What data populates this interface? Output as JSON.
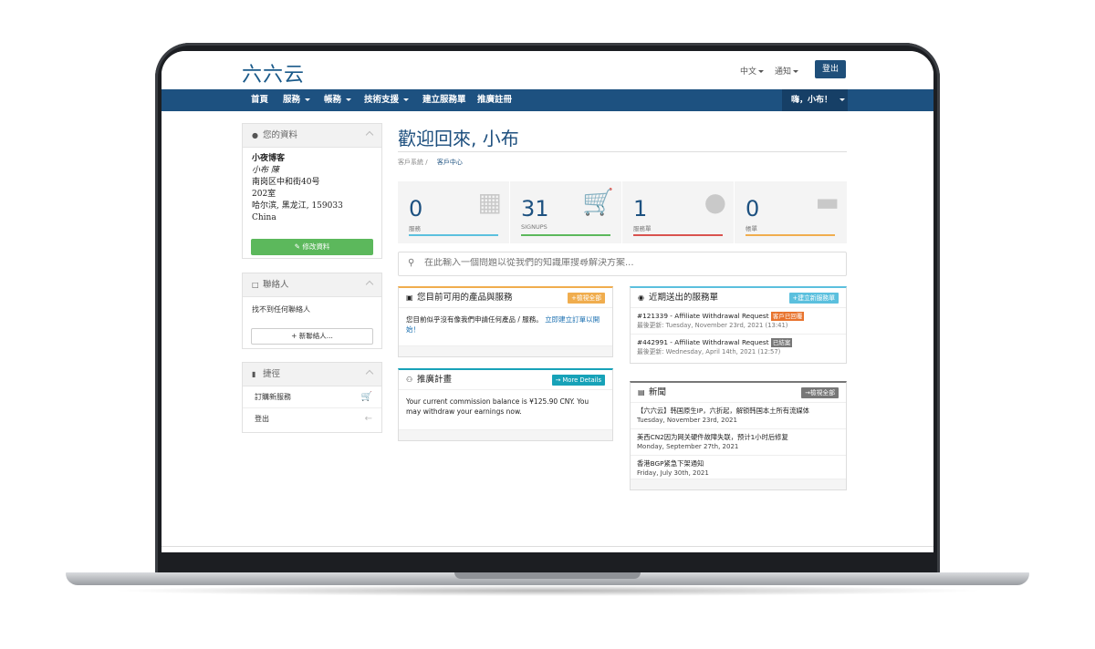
{
  "brand": {
    "logo": "六六云"
  },
  "topbar": {
    "language": "中文",
    "notifications": "通知",
    "logout": "登出"
  },
  "nav": {
    "items": [
      {
        "label": "首頁",
        "dropdown": false
      },
      {
        "label": "服務",
        "dropdown": true
      },
      {
        "label": "帳務",
        "dropdown": true
      },
      {
        "label": "技術支援",
        "dropdown": true
      },
      {
        "label": "建立服務單",
        "dropdown": false
      },
      {
        "label": "推廣註冊",
        "dropdown": false
      }
    ],
    "user": "嗨，小布！"
  },
  "profile": {
    "title": "您的資料",
    "lines": [
      "小夜博客",
      "小布 陳",
      "南岗区中和街40号",
      "202室",
      "哈尔滨, 黑龙江, 159033",
      "China"
    ],
    "edit_button": "修改資料"
  },
  "contacts": {
    "title": "聯絡人",
    "empty": "找不到任何聯絡人",
    "add_button": "新聯絡人..."
  },
  "shortcuts": {
    "title": "捷徑",
    "items": [
      "訂購新服務",
      "登出"
    ]
  },
  "main": {
    "welcome": "歡迎回來, 小布",
    "breadcrumb": [
      "客戶系統",
      "客戶中心"
    ],
    "search_placeholder": "在此輸入一個問題以從我們的知識庫搜尋解決方案..."
  },
  "stats": [
    {
      "value": "0",
      "label": "服務",
      "color": "#5bc0de",
      "icon": "cube-icon"
    },
    {
      "value": "31",
      "label": "SIGNUPS",
      "color": "#5cb85c",
      "icon": "cart-icon"
    },
    {
      "value": "1",
      "label": "服務單",
      "color": "#d9534f",
      "icon": "comments-icon"
    },
    {
      "value": "0",
      "label": "帳單",
      "color": "#f0ad4e",
      "icon": "credit-card-icon"
    }
  ],
  "products": {
    "title": "您目前可用的產品與服務",
    "button": "檢視全部",
    "text": "您目前似乎沒有像我們申請任何產品 / 服務。",
    "link": "立即建立訂單以開始！"
  },
  "affiliate": {
    "title": "推廣計畫",
    "button": "More Details",
    "text": "Your current commission balance is ¥125.90 CNY. You may withdraw your earnings now."
  },
  "tickets": {
    "title": "近期送出的服務單",
    "button": "建立新服務單",
    "items": [
      {
        "title": "#121339 - Affiliate Withdrawal Request",
        "status": "客戶已回覆",
        "status_color": "#e8732d",
        "updated": "最後更新: Tuesday, November 23rd, 2021 (13:41)"
      },
      {
        "title": "#442991 - Affiliate Withdrawal Request",
        "status": "已結案",
        "status_color": "#777777",
        "updated": "最後更新: Wednesday, April 14th, 2021 (12:57)"
      }
    ]
  },
  "news": {
    "title": "新聞",
    "button": "檢視全部",
    "items": [
      {
        "title": "【六六云】韩国原生IP，六折起，解锁韩国本土所有流媒体",
        "date": "Tuesday, November 23rd, 2021"
      },
      {
        "title": "美西CN2因为网关硬件故障失联，预计1小时后修复",
        "date": "Monday, September 27th, 2021"
      },
      {
        "title": "香港BGP紧急下架通知",
        "date": "Friday, July 30th, 2021"
      }
    ]
  },
  "colors": {
    "navbar": "#1d5180",
    "accent": "#1d4f7e",
    "green": "#5cb85c",
    "orange": "#f0ad4e",
    "teal": "#17a2b8",
    "info": "#5bc0de"
  }
}
